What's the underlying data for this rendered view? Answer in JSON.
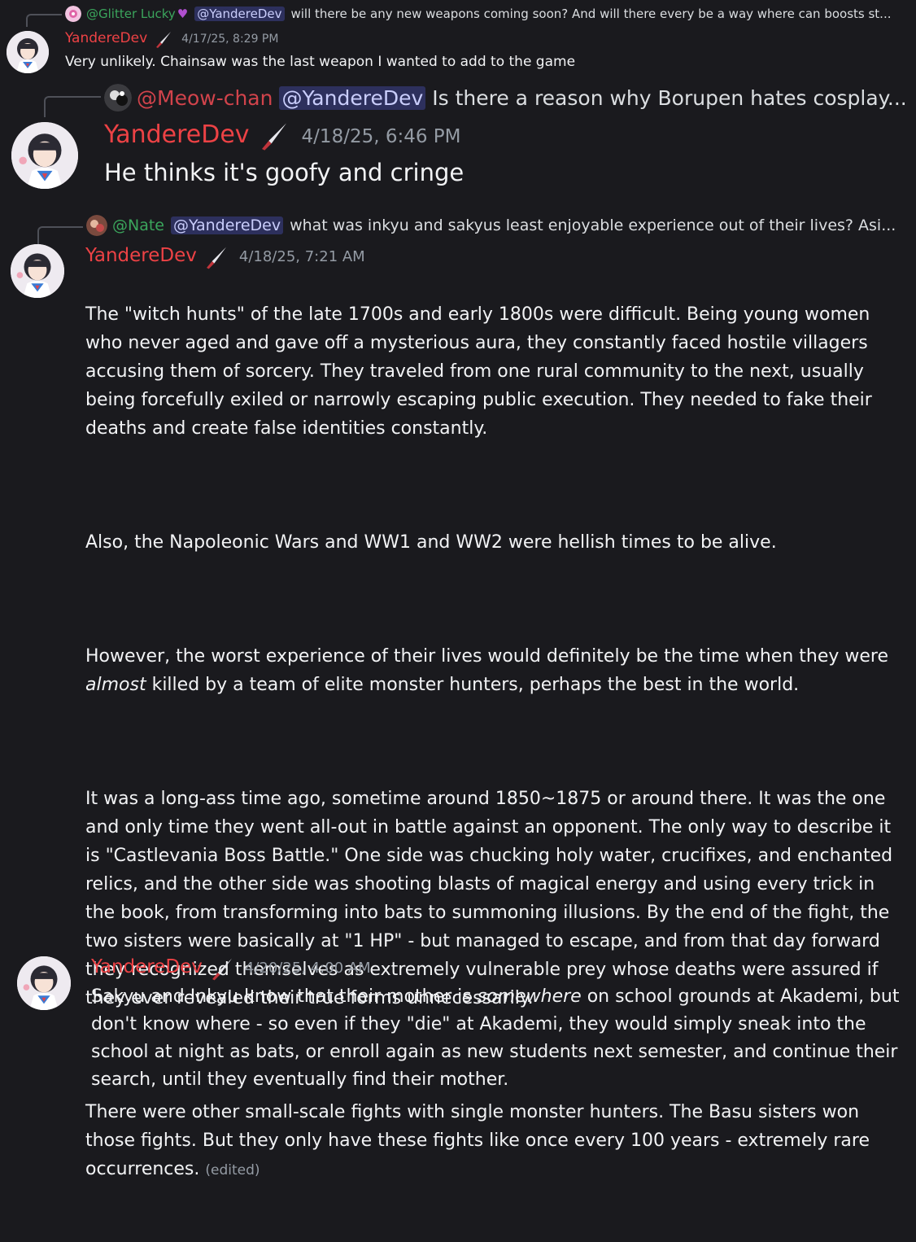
{
  "messages": [
    {
      "reply": {
        "user": "@Glitter Lucky",
        "mention": "@YandereDev",
        "text": "will there be any new weapons coming soon? And will there every be a way where can boosts st..."
      },
      "author": "YandereDev",
      "timestamp": "4/17/25, 8:29 PM",
      "text": "Very unlikely. Chainsaw was the last weapon I wanted to add to the game"
    },
    {
      "reply": {
        "user": "@Meow-chan",
        "mention": "@YandereDev",
        "text": "Is there a reason why Borupen hates cosplay..."
      },
      "author": "YandereDev",
      "timestamp": "4/18/25, 6:46 PM",
      "text": "He thinks it's goofy and cringe"
    },
    {
      "reply": {
        "user": "@Nate",
        "mention": "@YandereDev",
        "text": "what was inkyu and sakyus least enjoyable experience out of their lives? Asi..."
      },
      "author": "YandereDev",
      "timestamp": "4/18/25, 7:21 AM",
      "paragraphs": [
        "The \"witch hunts\" of the late 1700s and early 1800s were difficult. Being young women who never aged and gave off a mysterious aura, they constantly faced hostile villagers accusing them of sorcery. They traveled from one rural community to the next, usually being forcefully exiled or narrowly escaping public execution. They needed to fake their deaths and create false identities constantly.",
        "Also, the Napoleonic Wars and WW1 and WW2 were hellish times to be alive.",
        "However, the worst experience of their lives would definitely be the time when they were",
        "almost",
        "killed by a team of elite monster hunters, perhaps the best in the world.",
        "It was a long-ass time ago, sometime around 1850~1875 or around there. It was the one and only time they went all-out in battle against an opponent. The only way to describe it is \"Castlevania Boss Battle.\" One side was chucking holy water, crucifixes, and enchanted relics, and the other side was shooting blasts of magical energy and using every trick in the book, from transforming into bats to summoning illusions. By the end of the fight, the two sisters were basically at \"1 HP\" - but managed to escape, and from that day forward they recognized themselves as extremely vulnerable prey whose deaths were assured if they ever revealed their true forms unnecessarily.",
        "There were other small-scale fights with single monster hunters. The Basu sisters won those fights. But they only have these fights like once every 100 years - extremely rare occurrences."
      ],
      "edited": "(edited)"
    },
    {
      "author": "YandereDev",
      "timestamp": "4/20/25, 4:00 AM",
      "parts": [
        "Sakyu and Inkyu know that their mother is",
        "somewhere",
        "on school grounds at Akademi, but don't know where - so even if they \"die\" at Akademi, they would simply sneak into the school at night as bats, or enroll again as new students next semester, and continue their search, until they eventually find their mother."
      ]
    }
  ]
}
